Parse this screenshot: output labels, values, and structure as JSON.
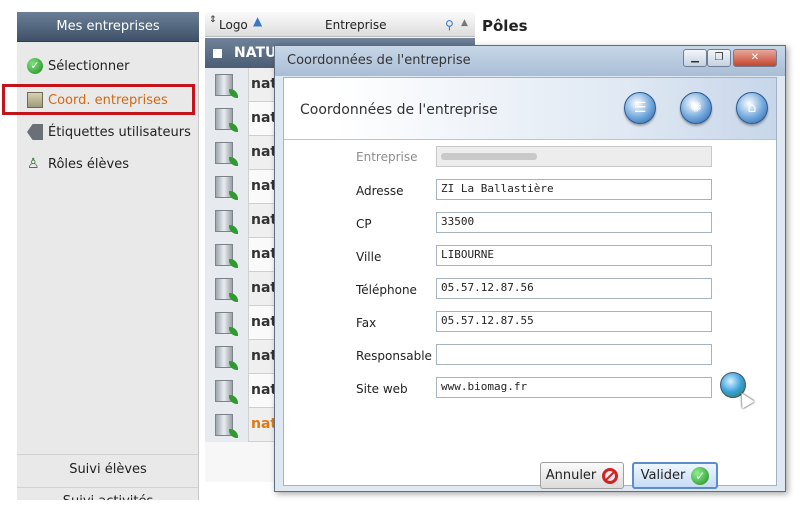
{
  "sidebar": {
    "header": "Mes entreprises",
    "items": [
      {
        "label": "Sélectionner"
      },
      {
        "label": "Coord. entreprises"
      },
      {
        "label": "Étiquettes utilisateurs"
      },
      {
        "label": "Rôles élèves"
      }
    ],
    "bottom": [
      {
        "label": "Suivi élèves"
      },
      {
        "label": "Suivi activités"
      }
    ]
  },
  "grid": {
    "col_logo": "Logo",
    "col_entreprise": "Entreprise",
    "group_label": "NATU",
    "row_label": "nat",
    "row_count": 11
  },
  "right_panel": {
    "title": "Pôles"
  },
  "dialog": {
    "title": "Coordonnées de l'entreprise",
    "banner_title": "Coordonnées de l'entreprise",
    "fields": {
      "entreprise": {
        "label": "Entreprise",
        "value": ""
      },
      "adresse": {
        "label": "Adresse",
        "value": "ZI La Ballastière"
      },
      "cp": {
        "label": "CP",
        "value": "33500"
      },
      "ville": {
        "label": "Ville",
        "value": "LIBOURNE"
      },
      "telephone": {
        "label": "Téléphone",
        "value": "05.57.12.87.56"
      },
      "fax": {
        "label": "Fax",
        "value": "05.57.12.87.55"
      },
      "responsable": {
        "label": "Responsable",
        "value": ""
      },
      "site_web": {
        "label": "Site web",
        "value": "www.biomag.fr"
      }
    },
    "buttons": {
      "cancel": "Annuler",
      "ok": "Valider"
    }
  }
}
